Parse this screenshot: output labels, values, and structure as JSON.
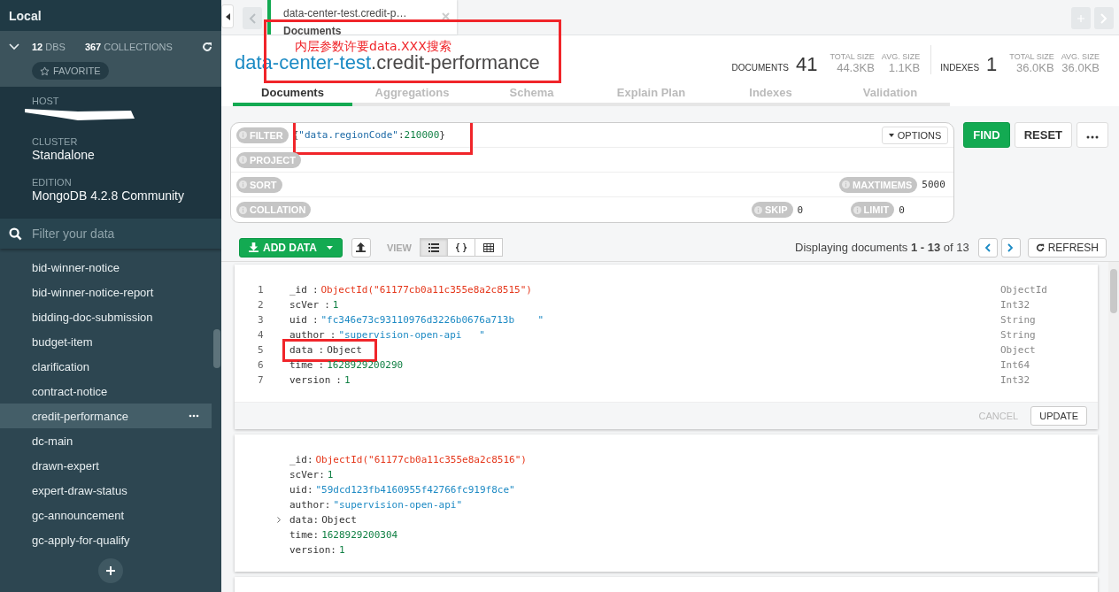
{
  "sidebar": {
    "title": "Local",
    "stats": [
      {
        "count": "12",
        "label": "DBS"
      },
      {
        "count": "367",
        "label": "COLLECTIONS"
      }
    ],
    "favorite": "FAVORITE",
    "info": [
      {
        "label": "HOST",
        "redacted": true
      },
      {
        "label": "CLUSTER",
        "value": "Standalone"
      },
      {
        "label": "EDITION",
        "value": "MongoDB 4.2.8 Community"
      }
    ],
    "filter": {
      "placeholder": "Filter your data"
    },
    "collections": [
      {
        "name": "bid-winner-notice",
        "selected": false
      },
      {
        "name": "bid-winner-notice-report",
        "selected": false
      },
      {
        "name": "bidding-doc-submission",
        "selected": false
      },
      {
        "name": "budget-item",
        "selected": false
      },
      {
        "name": "clarification",
        "selected": false
      },
      {
        "name": "contract-notice",
        "selected": false
      },
      {
        "name": "credit-performance",
        "selected": true
      },
      {
        "name": "dc-main",
        "selected": false
      },
      {
        "name": "drawn-expert",
        "selected": false
      },
      {
        "name": "expert-draw-status",
        "selected": false
      },
      {
        "name": "gc-announcement",
        "selected": false
      },
      {
        "name": "gc-apply-for-qualify",
        "selected": false
      }
    ]
  },
  "tab": {
    "title": "data-center-test.credit-p…",
    "subtitle": "Documents"
  },
  "header": {
    "db": "data-center-test",
    "collection": ".credit-performance",
    "stats": [
      {
        "label": "DOCUMENTS",
        "value": "41",
        "details": [
          {
            "label": "TOTAL SIZE",
            "value": "44.3KB"
          },
          {
            "label": "AVG. SIZE",
            "value": "1.1KB"
          }
        ]
      },
      {
        "label": "INDEXES",
        "value": "1",
        "details": [
          {
            "label": "TOTAL SIZE",
            "value": "36.0KB"
          },
          {
            "label": "AVG. SIZE",
            "value": "36.0KB"
          }
        ]
      }
    ]
  },
  "subtabs": [
    {
      "label": "Documents",
      "selected": true
    },
    {
      "label": "Aggregations",
      "selected": false
    },
    {
      "label": "Schema",
      "selected": false
    },
    {
      "label": "Explain Plan",
      "selected": false
    },
    {
      "label": "Indexes",
      "selected": false
    },
    {
      "label": "Validation",
      "selected": false
    }
  ],
  "annotation": {
    "note": "内层参数许要data.XXX搜索"
  },
  "query": {
    "filter": {
      "label": "FILTER",
      "parts": [
        {
          "text": "{",
          "kind": "punct"
        },
        {
          "text": "\"data.regionCode\"",
          "kind": "string"
        },
        {
          "text": ":",
          "kind": "punct"
        },
        {
          "text": "210000",
          "kind": "number"
        },
        {
          "text": "}",
          "kind": "punct"
        }
      ]
    },
    "options": "OPTIONS",
    "project": "PROJECT",
    "sort": "SORT",
    "maxtimems": {
      "label": "MAXTIMEMS",
      "value": "5000"
    },
    "collation": "COLLATION",
    "skip": {
      "label": "SKIP",
      "value": "0"
    },
    "limit": {
      "label": "LIMIT",
      "value": "0"
    },
    "buttons": {
      "find": "FIND",
      "reset": "RESET"
    }
  },
  "toolbar": {
    "add_data": "ADD DATA",
    "view_label": "VIEW",
    "views": [
      {
        "kind": "list",
        "selected": true
      },
      {
        "kind": "json",
        "selected": false
      },
      {
        "kind": "table",
        "selected": false
      }
    ],
    "pagination": "Displaying documents **1 - 13** of 13",
    "refresh": "REFRESH"
  },
  "documents": [
    {
      "kind": "editing",
      "fields": [
        {
          "line": "1",
          "key": "_id",
          "value": "ObjectId(\"61177cb0a11c355e8a2c8515\")",
          "kind": "objectid",
          "type": "ObjectId"
        },
        {
          "line": "2",
          "key": "scVer",
          "value": "1",
          "kind": "number",
          "type": "Int32"
        },
        {
          "line": "3",
          "key": "uid",
          "value": "\"fc346e73c93110976d3226b0676a713b    \"",
          "kind": "string",
          "type": "String"
        },
        {
          "line": "4",
          "key": "author",
          "value": "\"supervision-open-api   \"",
          "kind": "string",
          "type": "String"
        },
        {
          "line": "5",
          "key": "data",
          "value": "Object",
          "kind": "object",
          "type": "Object"
        },
        {
          "line": "6",
          "key": "time",
          "value": "1628929200290",
          "kind": "number",
          "type": "Int64"
        },
        {
          "line": "7",
          "key": "version",
          "value": "1",
          "kind": "number",
          "type": "Int32"
        }
      ],
      "separator": ":",
      "cancel": "CANCEL",
      "update": "UPDATE"
    },
    {
      "kind": "view",
      "separator": ":",
      "fields": [
        {
          "key": "_id",
          "value": "ObjectId(\"61177cb0a11c355e8a2c8516\")",
          "kind": "objectid"
        },
        {
          "key": "scVer",
          "value": "1",
          "kind": "number"
        },
        {
          "key": "uid",
          "value": "\"59dcd123fb4160955f42766fc919f8ce\"",
          "kind": "string"
        },
        {
          "key": "author",
          "value": "\"supervision-open-api\"",
          "kind": "string"
        },
        {
          "key": "data",
          "value": "Object",
          "kind": "object"
        },
        {
          "key": "time",
          "value": "1628929200304",
          "kind": "number"
        },
        {
          "key": "version",
          "value": "1",
          "kind": "number"
        }
      ]
    }
  ]
}
